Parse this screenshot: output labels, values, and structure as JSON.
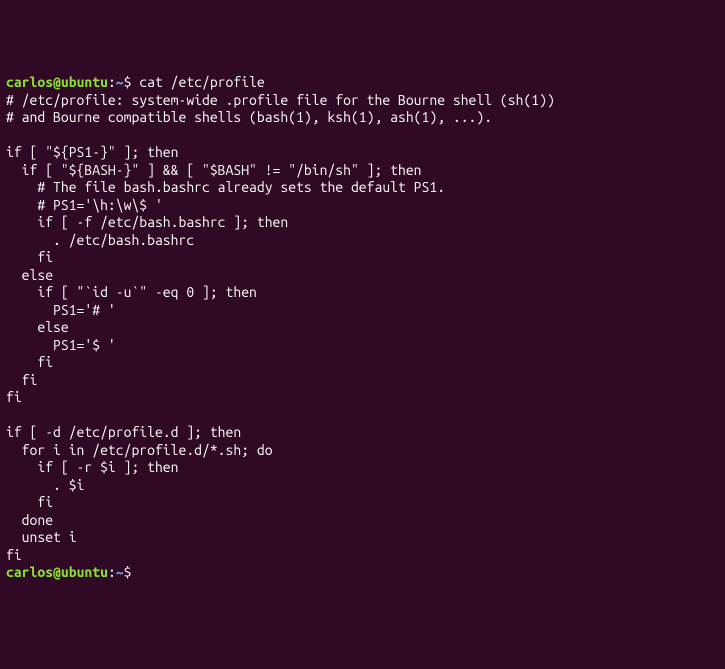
{
  "prompt": {
    "user": "carlos",
    "at": "@",
    "host": "ubuntu",
    "colon": ":",
    "path": "~",
    "dollar": "$"
  },
  "command": "cat /etc/profile",
  "output_lines": [
    "# /etc/profile: system-wide .profile file for the Bourne shell (sh(1))",
    "# and Bourne compatible shells (bash(1), ksh(1), ash(1), ...).",
    "",
    "if [ \"${PS1-}\" ]; then",
    "  if [ \"${BASH-}\" ] && [ \"$BASH\" != \"/bin/sh\" ]; then",
    "    # The file bash.bashrc already sets the default PS1.",
    "    # PS1='\\h:\\w\\$ '",
    "    if [ -f /etc/bash.bashrc ]; then",
    "      . /etc/bash.bashrc",
    "    fi",
    "  else",
    "    if [ \"`id -u`\" -eq 0 ]; then",
    "      PS1='# '",
    "    else",
    "      PS1='$ '",
    "    fi",
    "  fi",
    "fi",
    "",
    "if [ -d /etc/profile.d ]; then",
    "  for i in /etc/profile.d/*.sh; do",
    "    if [ -r $i ]; then",
    "      . $i",
    "    fi",
    "  done",
    "  unset i",
    "fi"
  ]
}
